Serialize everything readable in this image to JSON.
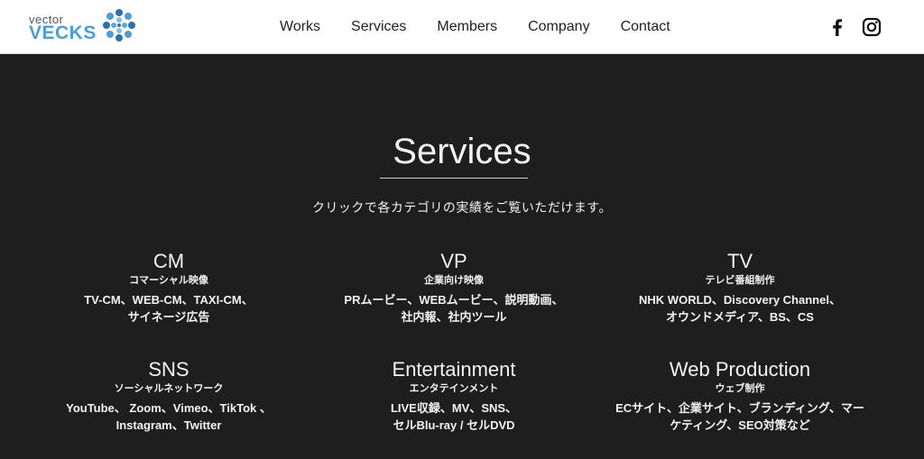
{
  "brand": {
    "small": "vector",
    "big": "VECKS",
    "colors": {
      "primary": "#4a9fd8",
      "accent": "#2d6fb3"
    }
  },
  "nav": {
    "items": [
      {
        "label": "Works"
      },
      {
        "label": "Services"
      },
      {
        "label": "Members"
      },
      {
        "label": "Company"
      },
      {
        "label": "Contact"
      }
    ]
  },
  "social": {
    "icons": [
      "facebook-icon",
      "instagram-icon"
    ]
  },
  "main": {
    "title": "Services",
    "subtitle": "クリックで各カテゴリの実績をご覧いただけます。",
    "services": [
      {
        "title": "CM",
        "sub": "コマーシャル映像",
        "desc": [
          "TV-CM、WEB-CM、TAXI-CM、",
          "サイネージ広告"
        ]
      },
      {
        "title": "VP",
        "sub": "企業向け映像",
        "desc": [
          "PRムービー、WEBムービー、説明動画、",
          "社内報、社内ツール"
        ]
      },
      {
        "title": "TV",
        "sub": "テレビ番組制作",
        "desc": [
          "NHK WORLD、Discovery Channel、",
          "オウンドメディア、BS、CS"
        ]
      },
      {
        "title": "SNS",
        "sub": "ソーシャルネットワーク",
        "desc": [
          "YouTube、 Zoom、Vimeo、TikTok 、",
          "Instagram、Twitter"
        ]
      },
      {
        "title": "Entertainment",
        "sub": "エンタテインメント",
        "desc": [
          "LIVE収録、MV、SNS、",
          "セルBlu-ray / セルDVD"
        ]
      },
      {
        "title": "Web Production",
        "sub": "ウェブ制作",
        "desc": [
          "ECサイト、企業サイト、ブランディング、マー",
          "ケティング、SEO対策など"
        ]
      }
    ]
  },
  "colors": {
    "background": "#1e1e1e",
    "text": "#f2f2f2",
    "header": "#ffffff"
  }
}
